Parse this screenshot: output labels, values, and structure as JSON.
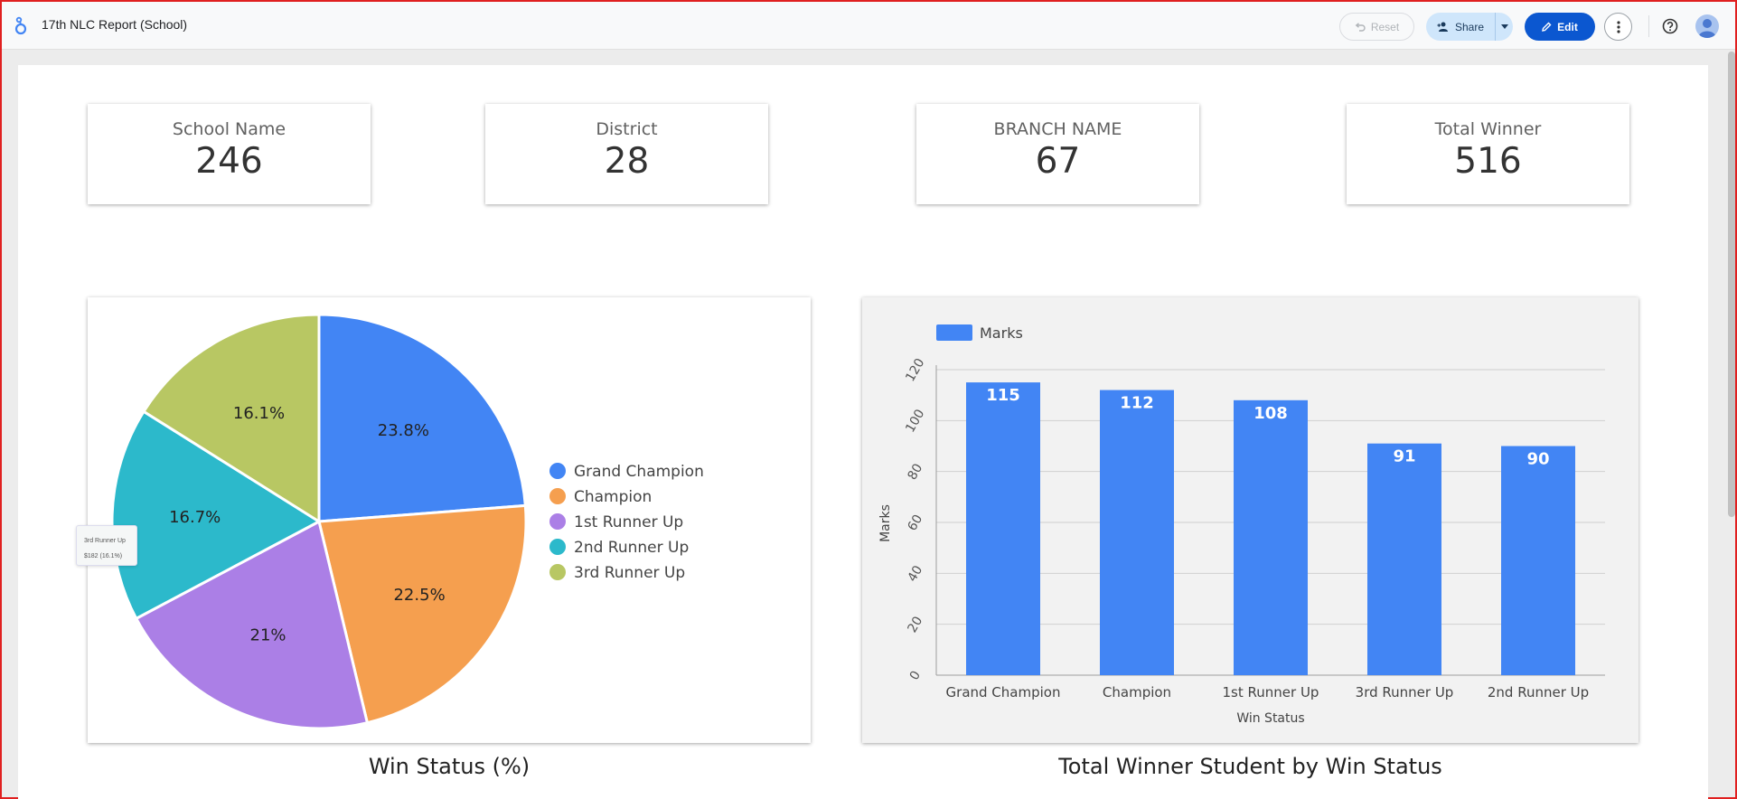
{
  "header": {
    "title": "17th NLC Report (School)",
    "reset_label": "Reset",
    "share_label": "Share",
    "edit_label": "Edit"
  },
  "kpis": [
    {
      "label": "School Name",
      "value": "246"
    },
    {
      "label": "District",
      "value": "28"
    },
    {
      "label": "BRANCH NAME",
      "value": "67"
    },
    {
      "label": "Total Winner",
      "value": "516"
    }
  ],
  "tooltip": {
    "title": "3rd Runner Up",
    "value": "$182 (16.1%)"
  },
  "colors": {
    "accent": "#0b57d0",
    "grand_champion": "#4285f4",
    "champion": "#f59f4f",
    "first_runner_up": "#ab7fe6",
    "second_runner_up": "#2cb9cb",
    "third_runner_up": "#b8c763"
  },
  "chart_data": [
    {
      "type": "pie",
      "title": "Win Status (%)",
      "series": [
        {
          "name": "Grand Champion",
          "value": 23.8,
          "label": "23.8%",
          "color": "#4285f4"
        },
        {
          "name": "Champion",
          "value": 22.5,
          "label": "22.5%",
          "color": "#f59f4f"
        },
        {
          "name": "1st Runner Up",
          "value": 21,
          "label": "21%",
          "color": "#ab7fe6"
        },
        {
          "name": "2nd Runner Up",
          "value": 16.7,
          "label": "16.7%",
          "color": "#2cb9cb"
        },
        {
          "name": "3rd Runner Up",
          "value": 16.1,
          "label": "16.1%",
          "color": "#b8c763"
        }
      ],
      "legend": "right"
    },
    {
      "type": "bar",
      "title": "Total Winner Student by Win Status",
      "categories": [
        "Grand Champion",
        "Champion",
        "1st Runner Up",
        "3rd Runner Up",
        "2nd Runner Up"
      ],
      "series": [
        {
          "name": "Marks",
          "values": [
            115,
            112,
            108,
            91,
            90
          ],
          "color": "#4285f4"
        }
      ],
      "xlabel": "Win Status",
      "ylabel": "Marks",
      "ylim": [
        0,
        120
      ],
      "yticks": [
        0,
        20,
        40,
        60,
        80,
        100,
        120
      ],
      "grid": true,
      "legend": "top-left"
    }
  ]
}
